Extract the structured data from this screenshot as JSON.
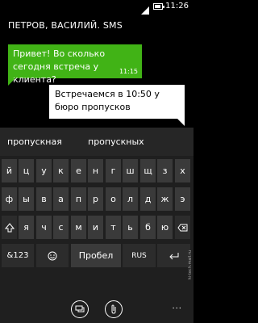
{
  "status": {
    "time": "11:26"
  },
  "header": {
    "title": "ПЕТРОВ, ВАСИЛИЙ. SMS"
  },
  "messages": [
    {
      "direction": "incoming",
      "text": "Привет! Во сколько сегодня встреча у клиента?",
      "time": "11:15"
    },
    {
      "direction": "outgoing",
      "text": "Встречаемся в 10:50 у бюро пропусков"
    }
  ],
  "keyboard": {
    "suggestions": [
      "пропускная",
      "пропускных"
    ],
    "row1": [
      "й",
      "ц",
      "у",
      "к",
      "е",
      "н",
      "г",
      "ш",
      "щ",
      "з",
      "х"
    ],
    "row2": [
      "ф",
      "ы",
      "в",
      "а",
      "п",
      "р",
      "о",
      "л",
      "д",
      "ж",
      "э"
    ],
    "row3": [
      "я",
      "ч",
      "с",
      "м",
      "и",
      "т",
      "ь",
      "б",
      "ю"
    ],
    "shift_icon": "shift-arrow-icon",
    "backspace_icon": "backspace-icon",
    "numbers_key": "&123",
    "emoji_icon": "smiley-icon",
    "space_key": "Пробел",
    "lang_key": "RUS",
    "enter_icon": "enter-icon"
  },
  "appbar": {
    "send_icon": "send-icon",
    "attach_icon": "paperclip-icon",
    "more": "..."
  },
  "watermark": "hi-tech.mail.ru",
  "colors": {
    "incoming_bubble": "#41b316",
    "outgoing_bubble": "#ffffff"
  }
}
